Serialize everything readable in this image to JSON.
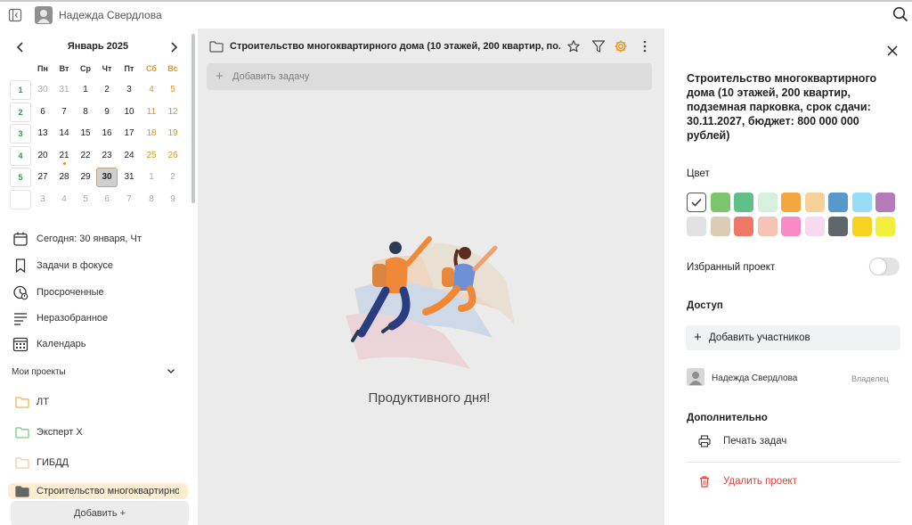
{
  "topbar": {
    "user_name": "Надежда Свердлова"
  },
  "calendar": {
    "title": "Январь 2025",
    "weekdays": [
      "Пн",
      "Вт",
      "Ср",
      "Чт",
      "Пт",
      "Сб",
      "Вс"
    ],
    "weeks": [
      {
        "num": "1",
        "days": [
          "30",
          "31",
          "1",
          "2",
          "3",
          "4",
          "5"
        ]
      },
      {
        "num": "2",
        "days": [
          "6",
          "7",
          "8",
          "9",
          "10",
          "11",
          "12"
        ]
      },
      {
        "num": "3",
        "days": [
          "13",
          "14",
          "15",
          "16",
          "17",
          "18",
          "19"
        ]
      },
      {
        "num": "4",
        "days": [
          "20",
          "21",
          "22",
          "23",
          "24",
          "25",
          "26"
        ]
      },
      {
        "num": "5",
        "days": [
          "27",
          "28",
          "29",
          "30",
          "31",
          "1",
          "2"
        ]
      },
      {
        "num": "",
        "days": [
          "3",
          "4",
          "5",
          "6",
          "7",
          "8",
          "9"
        ]
      }
    ]
  },
  "nav": {
    "today": "Сегодня: 30 января, Чт",
    "focus": "Задачи в фокусе",
    "overdue": "Просроченные",
    "unsorted": "Неразобранное",
    "calendar": "Календарь"
  },
  "projects": {
    "header": "Мои проекты",
    "items": [
      {
        "label": "ЛТ",
        "color": "#f5b14d"
      },
      {
        "label": "Эксперт Х",
        "color": "#7dc97f"
      },
      {
        "label": "ГИБДД",
        "color": "#f7c9a0"
      },
      {
        "label": "Строительство многоквартирного дома (10 этажей, 200 квартир, подземная парковка, срок сдачи: 30.11.2027, бюджет: 800 000 000 рублей)",
        "color": "#666666"
      }
    ],
    "add_label": "Добавить +"
  },
  "main": {
    "title": "Строительство многоквартирного дома (10 этажей, 200 квартир, по...",
    "add_task_placeholder": "Добавить задачу",
    "empty_message": "Продуктивного дня!"
  },
  "panel": {
    "title": "Строительство многоквартирного дома (10 этажей, 200 квартир, подземная парковка, срок сдачи: 30.11.2027, бюджет: 800 000 000 рублей)",
    "color_label": "Цвет",
    "colors": [
      "#ffffff",
      "#7dc56c",
      "#5fc08a",
      "#d7efde",
      "#f4a741",
      "#f8d199",
      "#5899cc",
      "#97ddf7",
      "#b47ab9",
      "#e2e2e2",
      "#dcccb5",
      "#ef7766",
      "#f8c3b7",
      "#f98ac6",
      "#f6dbf0",
      "#60666c",
      "#f5d31f",
      "#f2ef3c"
    ],
    "favorite_label": "Избранный проект",
    "access_label": "Доступ",
    "add_members": "Добавить участников",
    "member": {
      "name": "Надежда Свердлова",
      "role": "Владелец"
    },
    "extra_label": "Дополнительно",
    "print_label": "Печать задач",
    "delete_label": "Удалить проект"
  }
}
